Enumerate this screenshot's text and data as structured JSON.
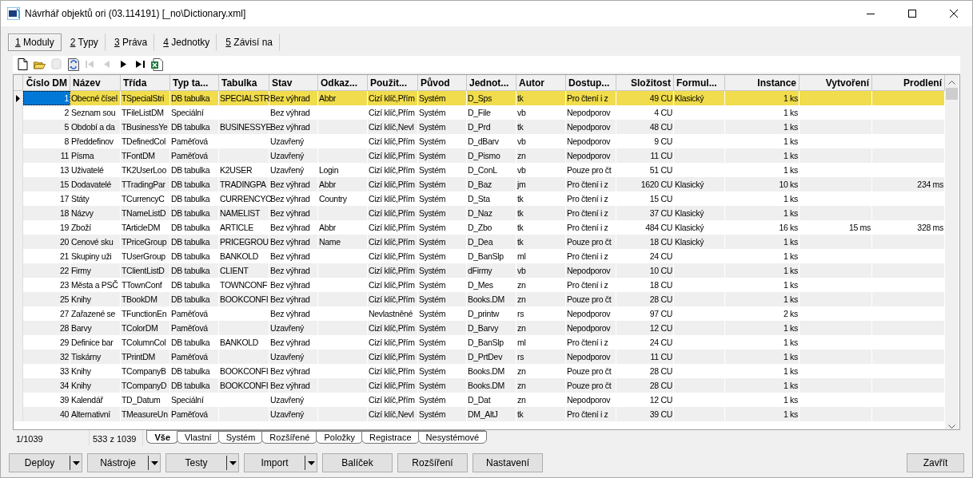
{
  "window": {
    "title": "Návrhář objektů ori (03.114191) [_no\\Dictionary.xml]"
  },
  "tabs": [
    {
      "hotkey": "1",
      "label": "Moduly",
      "selected": true
    },
    {
      "hotkey": "2",
      "label": "Typy",
      "selected": false
    },
    {
      "hotkey": "3",
      "label": "Práva",
      "selected": false
    },
    {
      "hotkey": "4",
      "label": "Jednotky",
      "selected": false
    },
    {
      "hotkey": "5",
      "label": "Závisí na",
      "selected": false
    }
  ],
  "toolbar": [
    {
      "kind": "new",
      "disabled": false
    },
    {
      "kind": "open",
      "disabled": false
    },
    {
      "kind": "delete",
      "disabled": true
    },
    {
      "kind": "refresh",
      "disabled": false
    },
    {
      "kind": "first",
      "disabled": true
    },
    {
      "kind": "prev",
      "disabled": true
    },
    {
      "kind": "next",
      "disabled": false
    },
    {
      "kind": "last",
      "disabled": false
    },
    {
      "kind": "excel",
      "disabled": false
    }
  ],
  "table": {
    "columns": [
      "Číslo DM",
      "Název",
      "Třída",
      "Typ ta...",
      "Tabulka",
      "Stav",
      "Odkaz...",
      "Použit...",
      "Původ",
      "Jednot...",
      "Autor",
      "Dostup...",
      "Složitost",
      "Formul...",
      "Instance",
      "Vytvoření",
      "Prodlení"
    ],
    "rows": [
      {
        "selected": true,
        "cells": [
          "1",
          "Obecné čísel",
          "TSpecialStri",
          "DB tabulka",
          "SPECIALSTR",
          "Bez výhrad",
          "Abbr",
          "Cizí klíč,Přím",
          "Systém",
          "D_Sps",
          "tk",
          "Pro čtení i z",
          "49 CU",
          "Klasický",
          "1 ks",
          null,
          null
        ]
      },
      {
        "selected": false,
        "cells": [
          "2",
          "Seznam sou",
          "TFileListDM",
          "Speciální",
          null,
          "Bez výhrad",
          null,
          "Cizí klíč,Přím",
          "Systém",
          "D_File",
          "vb",
          "Nepodporov",
          "4 CU",
          null,
          "1 ks",
          null,
          null
        ]
      },
      {
        "selected": false,
        "cells": [
          "5",
          "Období a da",
          "TBusinessYe",
          "DB tabulka",
          "BUSINESSYE",
          "Bez výhrad",
          null,
          "Cizí klíč,Nevl",
          "Systém",
          "D_Prd",
          "tk",
          "Nepodporov",
          "48 CU",
          null,
          "1 ks",
          null,
          null
        ]
      },
      {
        "selected": false,
        "cells": [
          "8",
          "Předdefinov",
          "TDefinedCol",
          "Paměťová",
          null,
          "Uzavřený",
          null,
          "Cizí klíč,Přím",
          "Systém",
          "D_dBarv",
          "vb",
          "Nepodporov",
          "9 CU",
          null,
          "1 ks",
          null,
          null
        ]
      },
      {
        "selected": false,
        "cells": [
          "11",
          "Písma",
          "TFontDM",
          "Paměťová",
          null,
          "Uzavřený",
          null,
          "Cizí klíč,Přím",
          "Systém",
          "D_Pismo",
          "zn",
          "Nepodporov",
          "11 CU",
          null,
          "1 ks",
          null,
          null
        ]
      },
      {
        "selected": false,
        "cells": [
          "13",
          "Uživatelé",
          "TK2UserLoo",
          "DB tabulka",
          "K2USER",
          "Uzavřený",
          "Login",
          "Cizí klíč,Přím",
          "Systém",
          "D_ConL",
          "vb",
          "Pouze pro čt",
          "51 CU",
          null,
          "1 ks",
          null,
          null
        ]
      },
      {
        "selected": false,
        "cells": [
          "15",
          "Dodavatelé",
          "TTradingPar",
          "DB tabulka",
          "TRADINGPA",
          "Bez výhrad",
          "Abbr",
          "Cizí klíč,Přím",
          "Systém",
          "D_Baz",
          "jm",
          "Pro čtení i z",
          "1620 CU",
          "Klasický",
          "10 ks",
          null,
          "234 ms"
        ]
      },
      {
        "selected": false,
        "cells": [
          "17",
          "Státy",
          "TCurrencyC",
          "DB tabulka",
          "CURRENCYC",
          "Bez výhrad",
          "Country",
          "Cizí klíč,Přím",
          "Systém",
          "D_Sta",
          "tk",
          "Pro čtení i z",
          "15 CU",
          null,
          "1 ks",
          null,
          null
        ]
      },
      {
        "selected": false,
        "cells": [
          "18",
          "Názvy",
          "TNameListD",
          "DB tabulka",
          "NAMELIST",
          "Bez výhrad",
          null,
          "Cizí klíč,Přím",
          "Systém",
          "D_Naz",
          "tk",
          "Pro čtení i z",
          "37 CU",
          "Klasický",
          "1 ks",
          null,
          null
        ]
      },
      {
        "selected": false,
        "cells": [
          "19",
          "Zboží",
          "TArticleDM",
          "DB tabulka",
          "ARTICLE",
          "Bez výhrad",
          "Abbr",
          "Cizí klíč,Přím",
          "Systém",
          "D_Zbo",
          "tk",
          "Pro čtení i z",
          "484 CU",
          "Klasický",
          "16 ks",
          "15 ms",
          "328 ms"
        ]
      },
      {
        "selected": false,
        "cells": [
          "20",
          "Cenové sku",
          "TPriceGroup",
          "DB tabulka",
          "PRICEGROU",
          "Bez výhrad",
          "Name",
          "Cizí klíč,Přím",
          "Systém",
          "D_Dea",
          "tk",
          "Pouze pro čt",
          "18 CU",
          "Klasický",
          "1 ks",
          null,
          null
        ]
      },
      {
        "selected": false,
        "cells": [
          "21",
          "Skupiny uži",
          "TUserGroup",
          "DB tabulka",
          "BANKOLD",
          "Bez výhrad",
          null,
          "Cizí klíč,Přím",
          "Systém",
          "D_BanSlp",
          "ml",
          "Pro čtení i z",
          "24 CU",
          null,
          "1 ks",
          null,
          null
        ]
      },
      {
        "selected": false,
        "cells": [
          "22",
          "Firmy",
          "TClientListD",
          "DB tabulka",
          "CLIENT",
          "Bez výhrad",
          null,
          "Cizí klíč,Přím",
          "Systém",
          "dFirmy",
          "vb",
          "Nepodporov",
          "10 CU",
          null,
          "1 ks",
          null,
          null
        ]
      },
      {
        "selected": false,
        "cells": [
          "23",
          "Města a PSČ",
          "TTownConf",
          "DB tabulka",
          "TOWNCONF",
          "Bez výhrad",
          null,
          "Cizí klíč,Přím",
          "Systém",
          "D_Mes",
          "zn",
          "Pro čtení i z",
          "18 CU",
          null,
          "1 ks",
          null,
          null
        ]
      },
      {
        "selected": false,
        "cells": [
          "25",
          "Knihy",
          "TBookDM",
          "DB tabulka",
          "BOOKCONFI",
          "Bez výhrad",
          null,
          "Cizí klíč,Přím",
          "Systém",
          "Books.DM",
          "zn",
          "Pouze pro čt",
          "28 CU",
          null,
          "1 ks",
          null,
          null
        ]
      },
      {
        "selected": false,
        "cells": [
          "27",
          "Zařazené se",
          "TFunctionEn",
          "Paměťová",
          null,
          "Bez výhrad",
          null,
          "Nevlastněné",
          "Systém",
          "D_printw",
          "rs",
          "Nepodporov",
          "97 CU",
          null,
          "2 ks",
          null,
          null
        ]
      },
      {
        "selected": false,
        "cells": [
          "28",
          "Barvy",
          "TColorDM",
          "Paměťová",
          null,
          "Uzavřený",
          null,
          "Cizí klíč,Přím",
          "Systém",
          "D_Barvy",
          "zn",
          "Nepodporov",
          "12 CU",
          null,
          "1 ks",
          null,
          null
        ]
      },
      {
        "selected": false,
        "cells": [
          "29",
          "Definice bar",
          "TColumnCol",
          "DB tabulka",
          "BANKOLD",
          "Bez výhrad",
          null,
          "Cizí klíč,Přím",
          "Systém",
          "D_BanSlp",
          "ml",
          "Pro čtení i z",
          "24 CU",
          null,
          "1 ks",
          null,
          null
        ]
      },
      {
        "selected": false,
        "cells": [
          "32",
          "Tiskárny",
          "TPrintDM",
          "Paměťová",
          null,
          "Uzavřený",
          null,
          "Cizí klíč,Přím",
          "Systém",
          "D_PrtDev",
          "rs",
          "Nepodporov",
          "11 CU",
          null,
          "1 ks",
          null,
          null
        ]
      },
      {
        "selected": false,
        "cells": [
          "33",
          "Knihy",
          "TCompanyB",
          "DB tabulka",
          "BOOKCONFI",
          "Bez výhrad",
          null,
          "Cizí klíč,Přím",
          "Systém",
          "Books.DM",
          "zn",
          "Pouze pro čt",
          "28 CU",
          null,
          "1 ks",
          null,
          null
        ]
      },
      {
        "selected": false,
        "cells": [
          "34",
          "Knihy",
          "TCompanyD",
          "DB tabulka",
          "BOOKCONFI",
          "Bez výhrad",
          null,
          "Cizí klíč,Přím",
          "Systém",
          "Books.DM",
          "zn",
          "Pouze pro čt",
          "28 CU",
          null,
          "1 ks",
          null,
          null
        ]
      },
      {
        "selected": false,
        "cells": [
          "39",
          "Kalendář",
          "TD_Datum",
          "Speciální",
          null,
          "Uzavřený",
          null,
          "Cizí klíč,Přím",
          "Systém",
          "D_Dat",
          "zn",
          "Nepodporov",
          "12 CU",
          null,
          "1 ks",
          null,
          null
        ]
      },
      {
        "selected": false,
        "cells": [
          "40",
          "Alternativní",
          "TMeasureUn",
          "Paměťová",
          null,
          "Uzavřený",
          null,
          "Cizí klíč,Nevl",
          "Systém",
          "DM_AltJ",
          "tk",
          "Pro čtení i z",
          "39 CU",
          null,
          "1 ks",
          null,
          null
        ]
      }
    ]
  },
  "status_bar": {
    "position": "1/1039",
    "count": "533 z 1039"
  },
  "filter_tabs": [
    {
      "label": "Vše",
      "selected": true
    },
    {
      "label": "Vlastní",
      "selected": false
    },
    {
      "label": "Systém",
      "selected": false
    },
    {
      "label": "Rozšířené",
      "selected": false
    },
    {
      "label": "Položky",
      "selected": false
    },
    {
      "label": "Registrace",
      "selected": false
    },
    {
      "label": "Nesystémové",
      "selected": false
    }
  ],
  "buttons": [
    {
      "label": "Deploy",
      "kind": "split"
    },
    {
      "label": "Nástroje",
      "kind": "split"
    },
    {
      "label": "Testy",
      "kind": "split"
    },
    {
      "label": "Import",
      "kind": "split"
    },
    {
      "label": "Balíček",
      "kind": "plain"
    },
    {
      "label": "Rozšíření",
      "kind": "plain"
    },
    {
      "label": "Nastavení",
      "kind": "plain"
    }
  ],
  "close_button": "Zavřít"
}
